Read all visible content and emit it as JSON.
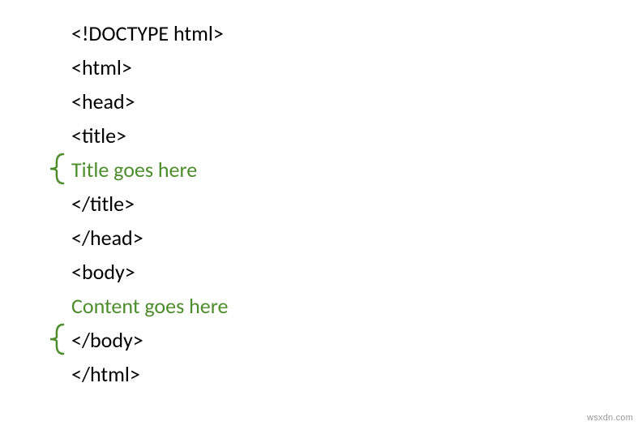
{
  "lines": {
    "l0": "<!DOCTYPE html>",
    "l1": "<html>",
    "l2": "<head>",
    "l3": "<title>",
    "l4": "Title goes here",
    "l5": "</title>",
    "l6": "</head>",
    "l7": "<body>",
    "l8": "Content goes here",
    "l9": "</body>",
    "l10": "</html>"
  },
  "watermark": "wsxdn.com"
}
